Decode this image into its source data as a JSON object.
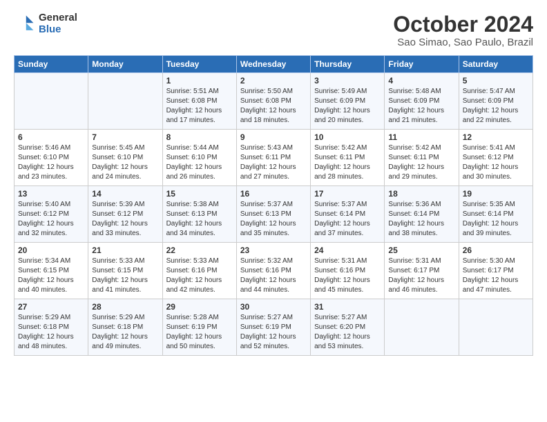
{
  "logo": {
    "general": "General",
    "blue": "Blue"
  },
  "title": "October 2024",
  "subtitle": "Sao Simao, Sao Paulo, Brazil",
  "days_header": [
    "Sunday",
    "Monday",
    "Tuesday",
    "Wednesday",
    "Thursday",
    "Friday",
    "Saturday"
  ],
  "weeks": [
    [
      {
        "day": "",
        "info": ""
      },
      {
        "day": "",
        "info": ""
      },
      {
        "day": "1",
        "info": "Sunrise: 5:51 AM\nSunset: 6:08 PM\nDaylight: 12 hours and 17 minutes."
      },
      {
        "day": "2",
        "info": "Sunrise: 5:50 AM\nSunset: 6:08 PM\nDaylight: 12 hours and 18 minutes."
      },
      {
        "day": "3",
        "info": "Sunrise: 5:49 AM\nSunset: 6:09 PM\nDaylight: 12 hours and 20 minutes."
      },
      {
        "day": "4",
        "info": "Sunrise: 5:48 AM\nSunset: 6:09 PM\nDaylight: 12 hours and 21 minutes."
      },
      {
        "day": "5",
        "info": "Sunrise: 5:47 AM\nSunset: 6:09 PM\nDaylight: 12 hours and 22 minutes."
      }
    ],
    [
      {
        "day": "6",
        "info": "Sunrise: 5:46 AM\nSunset: 6:10 PM\nDaylight: 12 hours and 23 minutes."
      },
      {
        "day": "7",
        "info": "Sunrise: 5:45 AM\nSunset: 6:10 PM\nDaylight: 12 hours and 24 minutes."
      },
      {
        "day": "8",
        "info": "Sunrise: 5:44 AM\nSunset: 6:10 PM\nDaylight: 12 hours and 26 minutes."
      },
      {
        "day": "9",
        "info": "Sunrise: 5:43 AM\nSunset: 6:11 PM\nDaylight: 12 hours and 27 minutes."
      },
      {
        "day": "10",
        "info": "Sunrise: 5:42 AM\nSunset: 6:11 PM\nDaylight: 12 hours and 28 minutes."
      },
      {
        "day": "11",
        "info": "Sunrise: 5:42 AM\nSunset: 6:11 PM\nDaylight: 12 hours and 29 minutes."
      },
      {
        "day": "12",
        "info": "Sunrise: 5:41 AM\nSunset: 6:12 PM\nDaylight: 12 hours and 30 minutes."
      }
    ],
    [
      {
        "day": "13",
        "info": "Sunrise: 5:40 AM\nSunset: 6:12 PM\nDaylight: 12 hours and 32 minutes."
      },
      {
        "day": "14",
        "info": "Sunrise: 5:39 AM\nSunset: 6:12 PM\nDaylight: 12 hours and 33 minutes."
      },
      {
        "day": "15",
        "info": "Sunrise: 5:38 AM\nSunset: 6:13 PM\nDaylight: 12 hours and 34 minutes."
      },
      {
        "day": "16",
        "info": "Sunrise: 5:37 AM\nSunset: 6:13 PM\nDaylight: 12 hours and 35 minutes."
      },
      {
        "day": "17",
        "info": "Sunrise: 5:37 AM\nSunset: 6:14 PM\nDaylight: 12 hours and 37 minutes."
      },
      {
        "day": "18",
        "info": "Sunrise: 5:36 AM\nSunset: 6:14 PM\nDaylight: 12 hours and 38 minutes."
      },
      {
        "day": "19",
        "info": "Sunrise: 5:35 AM\nSunset: 6:14 PM\nDaylight: 12 hours and 39 minutes."
      }
    ],
    [
      {
        "day": "20",
        "info": "Sunrise: 5:34 AM\nSunset: 6:15 PM\nDaylight: 12 hours and 40 minutes."
      },
      {
        "day": "21",
        "info": "Sunrise: 5:33 AM\nSunset: 6:15 PM\nDaylight: 12 hours and 41 minutes."
      },
      {
        "day": "22",
        "info": "Sunrise: 5:33 AM\nSunset: 6:16 PM\nDaylight: 12 hours and 42 minutes."
      },
      {
        "day": "23",
        "info": "Sunrise: 5:32 AM\nSunset: 6:16 PM\nDaylight: 12 hours and 44 minutes."
      },
      {
        "day": "24",
        "info": "Sunrise: 5:31 AM\nSunset: 6:16 PM\nDaylight: 12 hours and 45 minutes."
      },
      {
        "day": "25",
        "info": "Sunrise: 5:31 AM\nSunset: 6:17 PM\nDaylight: 12 hours and 46 minutes."
      },
      {
        "day": "26",
        "info": "Sunrise: 5:30 AM\nSunset: 6:17 PM\nDaylight: 12 hours and 47 minutes."
      }
    ],
    [
      {
        "day": "27",
        "info": "Sunrise: 5:29 AM\nSunset: 6:18 PM\nDaylight: 12 hours and 48 minutes."
      },
      {
        "day": "28",
        "info": "Sunrise: 5:29 AM\nSunset: 6:18 PM\nDaylight: 12 hours and 49 minutes."
      },
      {
        "day": "29",
        "info": "Sunrise: 5:28 AM\nSunset: 6:19 PM\nDaylight: 12 hours and 50 minutes."
      },
      {
        "day": "30",
        "info": "Sunrise: 5:27 AM\nSunset: 6:19 PM\nDaylight: 12 hours and 52 minutes."
      },
      {
        "day": "31",
        "info": "Sunrise: 5:27 AM\nSunset: 6:20 PM\nDaylight: 12 hours and 53 minutes."
      },
      {
        "day": "",
        "info": ""
      },
      {
        "day": "",
        "info": ""
      }
    ]
  ]
}
